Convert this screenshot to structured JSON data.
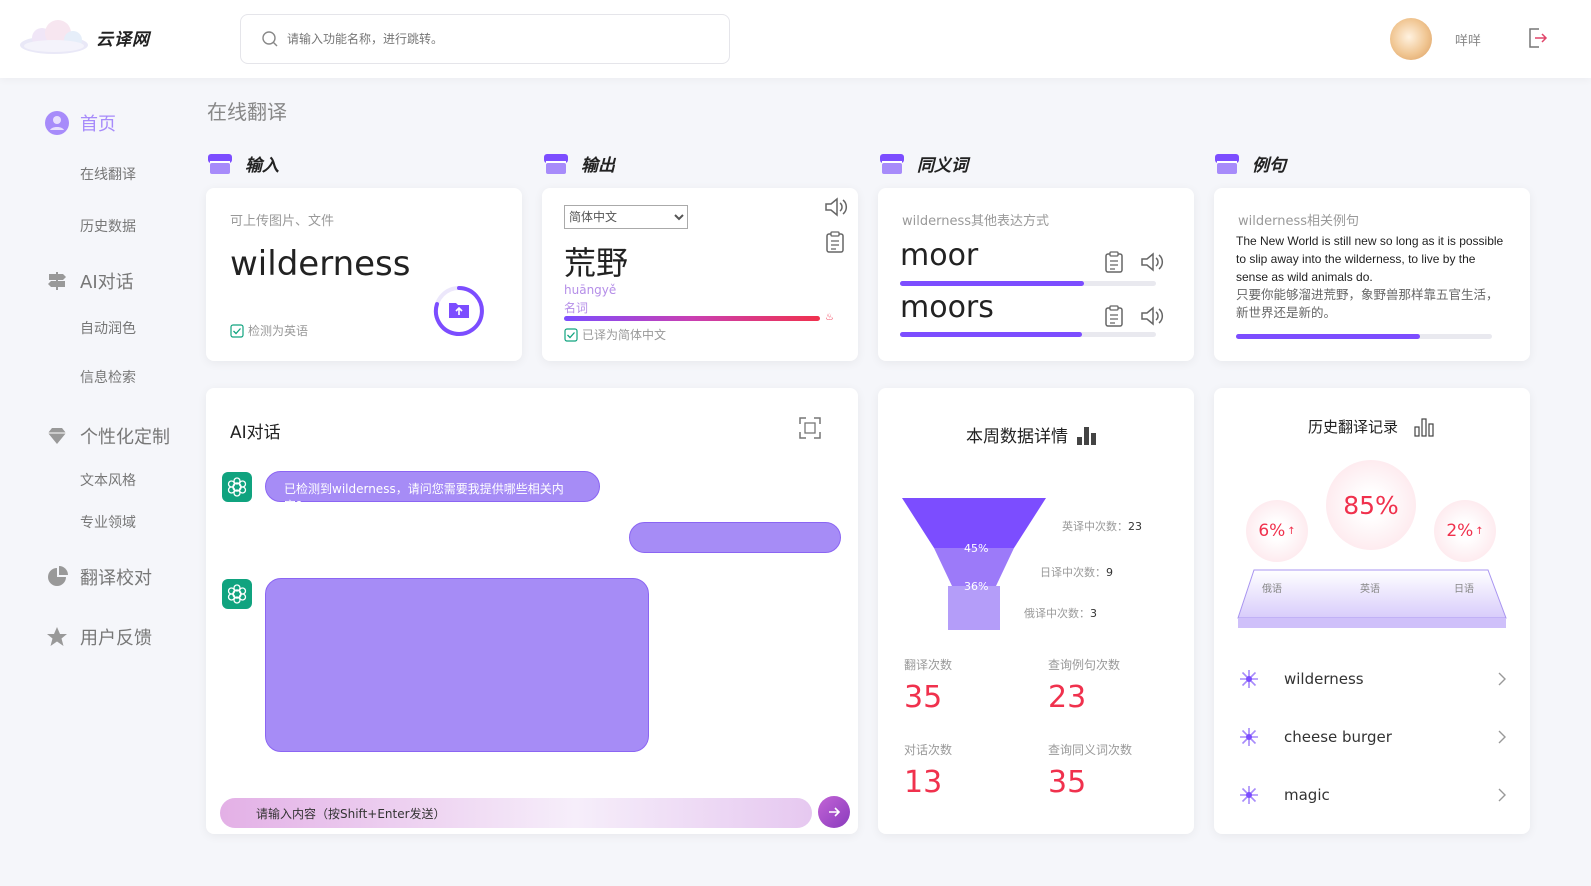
{
  "brand": {
    "name": "云译网"
  },
  "search": {
    "placeholder": "请输入功能名称，进行跳转。"
  },
  "user": {
    "name": "咩咩"
  },
  "sidebar": {
    "home": "首页",
    "online_translate": "在线翻译",
    "history": "历史数据",
    "ai_chat": "AI对话",
    "auto_polish": "自动润色",
    "info_search": "信息检索",
    "personalize": "个性化定制",
    "text_style": "文本风格",
    "domain": "专业领域",
    "proofread": "翻译校对",
    "feedback": "用户反馈"
  },
  "page": {
    "title": "在线翻译"
  },
  "sections": {
    "input": "输入",
    "output": "输出",
    "synonyms": "同义词",
    "examples": "例句"
  },
  "input_card": {
    "hint": "可上传图片、文件",
    "text": "wilderness",
    "detected": "检测为英语"
  },
  "output_card": {
    "language": "简体中文",
    "language_options": [
      "简体中文"
    ],
    "text": "荒野",
    "pinyin": "huāngyě",
    "pos": "名词",
    "status": "已译为简体中文",
    "progress": 1.0
  },
  "synonym_card": {
    "hint": "wilderness其他表达方式",
    "items": [
      {
        "word": "moor",
        "score": 0.72
      },
      {
        "word": "moors",
        "score": 0.71
      }
    ]
  },
  "example_card": {
    "hint": "wilderness相关例句",
    "en": "The New World is still new so long as it is possible to slip away into the wilderness, to live by the sense as wild animals do.",
    "zh": "只要你能够溜进荒野，象野兽那样靠五官生活，新世界还是新的。",
    "progress": 0.72
  },
  "chat": {
    "title": "AI对话",
    "bot_message": "已检测到wilderness，请问您需要我提供哪些相关内容?",
    "input_placeholder": "请输入内容（按Shift+Enter发送）"
  },
  "weekly": {
    "title": "本周数据详情",
    "funnel": [
      {
        "label": "英译中次数：",
        "value": 23
      },
      {
        "label": "日译中次数：",
        "value": 9
      },
      {
        "label": "俄译中次数：",
        "value": 3
      }
    ],
    "funnel_pcts": [
      "45%",
      "36%"
    ],
    "stats": [
      {
        "label": "翻译次数",
        "value": "35"
      },
      {
        "label": "查询例句次数",
        "value": "23"
      },
      {
        "label": "对话次数",
        "value": "13"
      },
      {
        "label": "查询同义词次数",
        "value": "35"
      }
    ]
  },
  "history": {
    "title": "历史翻译记录",
    "bubbles": [
      {
        "pct": "6%",
        "lang": "俄语",
        "trend": "↑"
      },
      {
        "pct": "85%",
        "lang": "英语",
        "trend": ""
      },
      {
        "pct": "2%",
        "lang": "日语",
        "trend": "↑"
      }
    ],
    "items": [
      "wilderness",
      "cheese burger",
      "magic"
    ]
  },
  "colors": {
    "accent": "#7c4dff",
    "red": "#f0314d",
    "green": "#10a37f"
  }
}
